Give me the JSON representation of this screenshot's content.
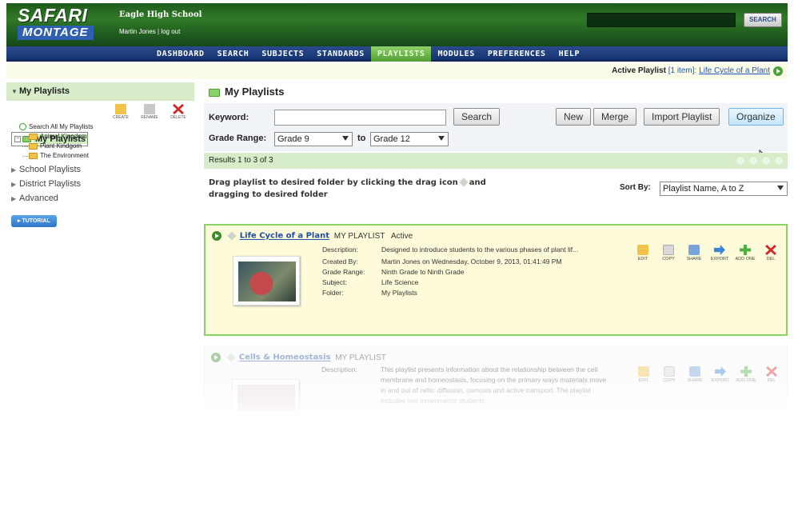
{
  "brand": {
    "line1": "SAFARI",
    "line2": "MONTAGE"
  },
  "header": {
    "school": "Eagle High School",
    "user": "Martin Jones",
    "sep": " | ",
    "logout": "log out",
    "search_button": "SEARCH"
  },
  "nav": {
    "items": [
      "DASHBOARD",
      "SEARCH",
      "SUBJECTS",
      "STANDARDS",
      "PLAYLISTS",
      "MODULES",
      "PREFERENCES",
      "HELP"
    ],
    "active": "PLAYLISTS"
  },
  "active_playlist": {
    "label": "Active Playlist",
    "count": "[1 item]:",
    "name": "Life Cycle of a Plant"
  },
  "sidebar": {
    "title": "My Playlists",
    "tools": [
      "CREATE",
      "RENAME",
      "DELETE"
    ],
    "tree": {
      "search_all": "Search All My Playlists",
      "my_playlists": "My Playlists",
      "folders": [
        "Animal Kingdom",
        "Plant Kindgom",
        "The Environment"
      ]
    },
    "sections": [
      "School Playlists",
      "District Playlists",
      "Advanced"
    ],
    "tutorial": "TUTORIAL"
  },
  "main": {
    "title": "My Playlists",
    "keyword_label": "Keyword:",
    "search_button": "Search",
    "buttons": [
      "New",
      "Merge",
      "Import Playlist",
      "Organize"
    ],
    "grade_range_label": "Grade Range:",
    "grade_from": "Grade 9",
    "grade_to_label": "to",
    "grade_to": "Grade 12",
    "results": "Results 1 to 3 of 3",
    "drag_hint_1": "Drag playlist to desired folder by clicking the drag icon",
    "drag_hint_2": "and",
    "drag_hint_3": "dragging to desired folder",
    "sort_label": "Sort By:",
    "sort_value": "Playlist Name, A to Z"
  },
  "playlists": [
    {
      "title": "Life Cycle of a Plant",
      "type": "MY PLAYLIST",
      "status": "Active",
      "description": "Designed to introduce students to the various phases of plant lif...",
      "created_by": "Martin Jones on Wednesday, October 9, 2013, 01:41:49 PM",
      "grade_range": "Ninth Grade to Ninth Grade",
      "subject": "Life Science",
      "folder": "My Playlists"
    },
    {
      "title": "Cells & Homeostasis",
      "type": "MY PLAYLIST",
      "description": "This playlist presents information about the relationship between the cell membrane and homeostasis, focusing on the primary ways materials move in and out of cells: diffusion, osmosis and active transport. The playlist includes two experiments students..."
    }
  ],
  "field_labels": {
    "description": "Description:",
    "created_by": "Created By:",
    "grade_range": "Grade Range:",
    "subject": "Subject:",
    "folder": "Folder:"
  },
  "actions": [
    "EDIT",
    "COPY",
    "SHARE",
    "EXPORT",
    "ADD ONE",
    "DEL"
  ],
  "colors": {
    "header_green": "#2f7a26",
    "nav_blue": "#163370",
    "nav_active": "#6bbb4c",
    "active_card_border": "#86d464",
    "link_blue": "#2358b8"
  }
}
